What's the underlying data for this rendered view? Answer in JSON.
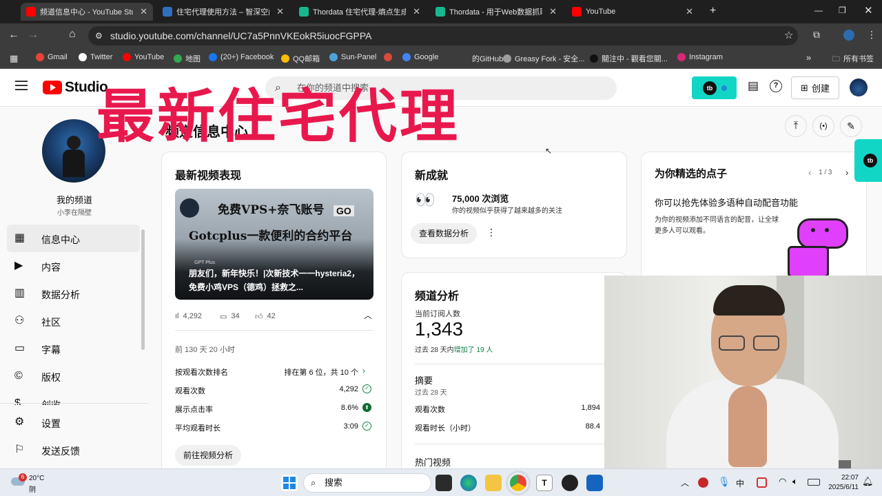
{
  "browser": {
    "tabs": [
      {
        "title": "频道信息中心 - YouTube Studi",
        "icon": "youtube-icon",
        "color": "#ff0000",
        "active": true
      },
      {
        "title": "住宅代理使用方法 – 智深空间",
        "icon": "wordpress-icon",
        "color": "#2f6fbf",
        "active": false
      },
      {
        "title": "Thordata 住宅代理-熵点生成器",
        "icon": "thordata-icon",
        "color": "#17b890",
        "active": false
      },
      {
        "title": "Thordata - 用于Web数据抓取",
        "icon": "thordata-icon",
        "color": "#17b890",
        "active": false
      },
      {
        "title": "YouTube",
        "icon": "youtube-icon",
        "color": "#ff0000",
        "active": false
      }
    ],
    "url": "studio.youtube.com/channel/UC7a5PnnVKEokR5iuocFGPPA",
    "bookmarks": [
      {
        "label": "Gmail",
        "color": "#ea4335"
      },
      {
        "label": "Twitter",
        "color": "#ffffff"
      },
      {
        "label": "YouTube",
        "color": "#ff0000"
      },
      {
        "label": "地图",
        "color": "#34a853"
      },
      {
        "label": "(20+) Facebook",
        "color": "#1877f2"
      },
      {
        "label": "QQ邮箱",
        "color": "#fbbc04"
      },
      {
        "label": "Sun-Panel",
        "color": "#4aa3df"
      },
      {
        "label": "",
        "color": "#d84a3a"
      },
      {
        "label": "Google",
        "color": "#4285f4"
      },
      {
        "label": "的GitHub",
        "color": "#3c3c3c"
      },
      {
        "label": "Greasy Fork - 安全...",
        "color": "#9e9e9e"
      },
      {
        "label": "關注中 - 觀看您關...",
        "color": "#111111"
      },
      {
        "label": "Instagram",
        "color": "#d62976"
      }
    ],
    "all_bookmarks": "所有书签"
  },
  "studio": {
    "logo_text": "Studio",
    "search_placeholder": "在你的频道中搜索",
    "create_label": "创建",
    "accent": "#12d6c5"
  },
  "overlay_title": "最新住宅代理",
  "sidebar": {
    "channel_name": "我的频道",
    "channel_handle": "小李在隔壁",
    "items": [
      {
        "label": "信息中心",
        "icon": "dashboard-icon",
        "active": true
      },
      {
        "label": "内容",
        "icon": "content-icon",
        "active": false
      },
      {
        "label": "数据分析",
        "icon": "analytics-icon",
        "active": false
      },
      {
        "label": "社区",
        "icon": "community-icon",
        "active": false
      },
      {
        "label": "字幕",
        "icon": "subtitles-icon",
        "active": false
      },
      {
        "label": "版权",
        "icon": "copyright-icon",
        "active": false
      },
      {
        "label": "创收",
        "icon": "earn-icon",
        "active": false
      }
    ],
    "bottom": [
      {
        "label": "设置",
        "icon": "settings-icon"
      },
      {
        "label": "发送反馈",
        "icon": "feedback-icon"
      }
    ]
  },
  "page_title": "频道信息中心",
  "latest_video": {
    "heading": "最新视频表现",
    "thumb_line1": "免费VPS+奈飞账号",
    "thumb_line2": "Gotcplus一款便利的合约平台",
    "thumb_go": "GO",
    "thumb_badge": "GPT Plus",
    "title": "朋友们，新年快乐！|次新技术一一hysteria2，免费小鸡VPS（德鸡）拯救之...",
    "views": "4,292",
    "comments": "34",
    "likes": "42",
    "age": "前 130 天 20 小时",
    "stats": [
      {
        "label": "按观看次数排名",
        "value": "排在第 6 位，共 10 个"
      },
      {
        "label": "观看次数",
        "value": "4,292"
      },
      {
        "label": "展示点击率",
        "value": "8.6%"
      },
      {
        "label": "平均观看时长",
        "value": "3:09"
      }
    ],
    "button": "前往视频分析"
  },
  "achievement": {
    "heading": "新成就",
    "emoji": "👀",
    "value": "75,000 次浏览",
    "desc": "你的视频似乎获得了越来越多的关注",
    "button": "查看数据分析"
  },
  "channel_analytics": {
    "heading": "频道分析",
    "subs_label": "当前订阅人数",
    "subs_value": "1,343",
    "change_prefix": "过去 28 天内",
    "change_text": "增加了 19 人",
    "summary_heading": "摘要",
    "summary_period": "过去 28 天",
    "rows": [
      {
        "label": "观看次数",
        "value": "1,894"
      },
      {
        "label": "观看时长（小时）",
        "value": "88.4"
      }
    ],
    "top_videos": "热门视频"
  },
  "ideas": {
    "heading": "为你精选的点子",
    "pager": "1 / 3",
    "title": "你可以抢先体验多语种自动配音功能",
    "desc": "为你的视频添加不同语言的配音，让全球更多人可以观看。"
  },
  "taskbar": {
    "weather_temp": "20°C",
    "weather_desc": "阴",
    "weather_badge": "6",
    "search_label": "搜索",
    "time": "22:07",
    "date": "2025/6/11",
    "ime": "中"
  }
}
